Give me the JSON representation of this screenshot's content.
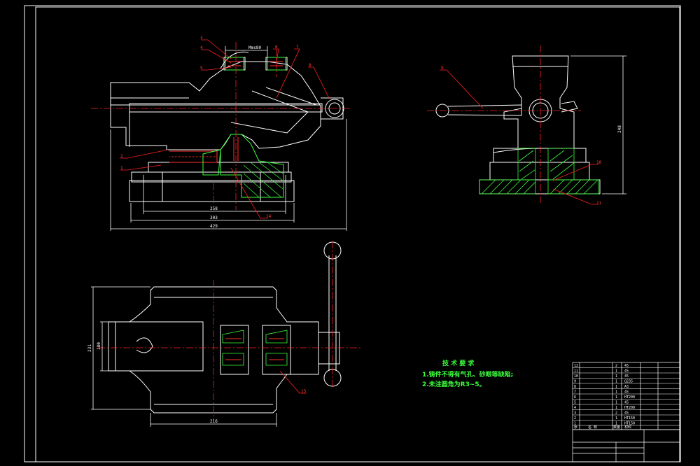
{
  "colors": {
    "background": "#000000",
    "outline": "#ffffff",
    "center_line": "#ff2020",
    "leader": "#ff2020",
    "hatch": "#3cff3c",
    "threads": "#ff3030",
    "dimension": "#ffffff",
    "border": "#ffffff"
  },
  "front_view": {
    "dimensions": {
      "jaw_width": "Mms80",
      "base_inner": "258",
      "base_outer": "303",
      "overall": "429"
    },
    "balloons": [
      "3",
      "4",
      "5",
      "6",
      "7",
      "8",
      "2",
      "1",
      "14"
    ]
  },
  "side_view": {
    "dimensions": {
      "height": "248"
    },
    "balloons": [
      "9",
      "10",
      "11"
    ]
  },
  "top_view": {
    "dimensions": {
      "width_outer": "231",
      "width_inner": "180",
      "length": "216"
    },
    "balloons": [
      "15"
    ]
  },
  "technical_requirements": {
    "title": "技 术 要 求",
    "lines": [
      "1.铸件不得有气孔、砂眼等缺陷;",
      "2.未注圆角为R3~5。"
    ]
  },
  "parts_list": {
    "rows": [
      {
        "no": "12",
        "name": "",
        "qty": "2",
        "material": "45"
      },
      {
        "no": "11",
        "name": "",
        "qty": "1",
        "material": "45"
      },
      {
        "no": "10",
        "name": "",
        "qty": "1",
        "material": "45"
      },
      {
        "no": "9",
        "name": "",
        "qty": "1",
        "material": "Q235"
      },
      {
        "no": "8",
        "name": "",
        "qty": "1",
        "material": "A3"
      },
      {
        "no": "7",
        "name": "",
        "qty": "1",
        "material": "45"
      },
      {
        "no": "6",
        "name": "",
        "qty": "1",
        "material": "HT200"
      },
      {
        "no": "5",
        "name": "",
        "qty": "1",
        "material": "45"
      },
      {
        "no": "4",
        "name": "",
        "qty": "1",
        "material": "HT200"
      },
      {
        "no": "3",
        "name": "",
        "qty": "2",
        "material": "45"
      },
      {
        "no": "2",
        "name": "",
        "qty": "1",
        "material": "HT150"
      },
      {
        "no": "1",
        "name": "",
        "qty": "1",
        "material": "HT150"
      }
    ],
    "header": {
      "no": "序",
      "name": "名 称",
      "qty": "数量",
      "material": "材料"
    }
  }
}
